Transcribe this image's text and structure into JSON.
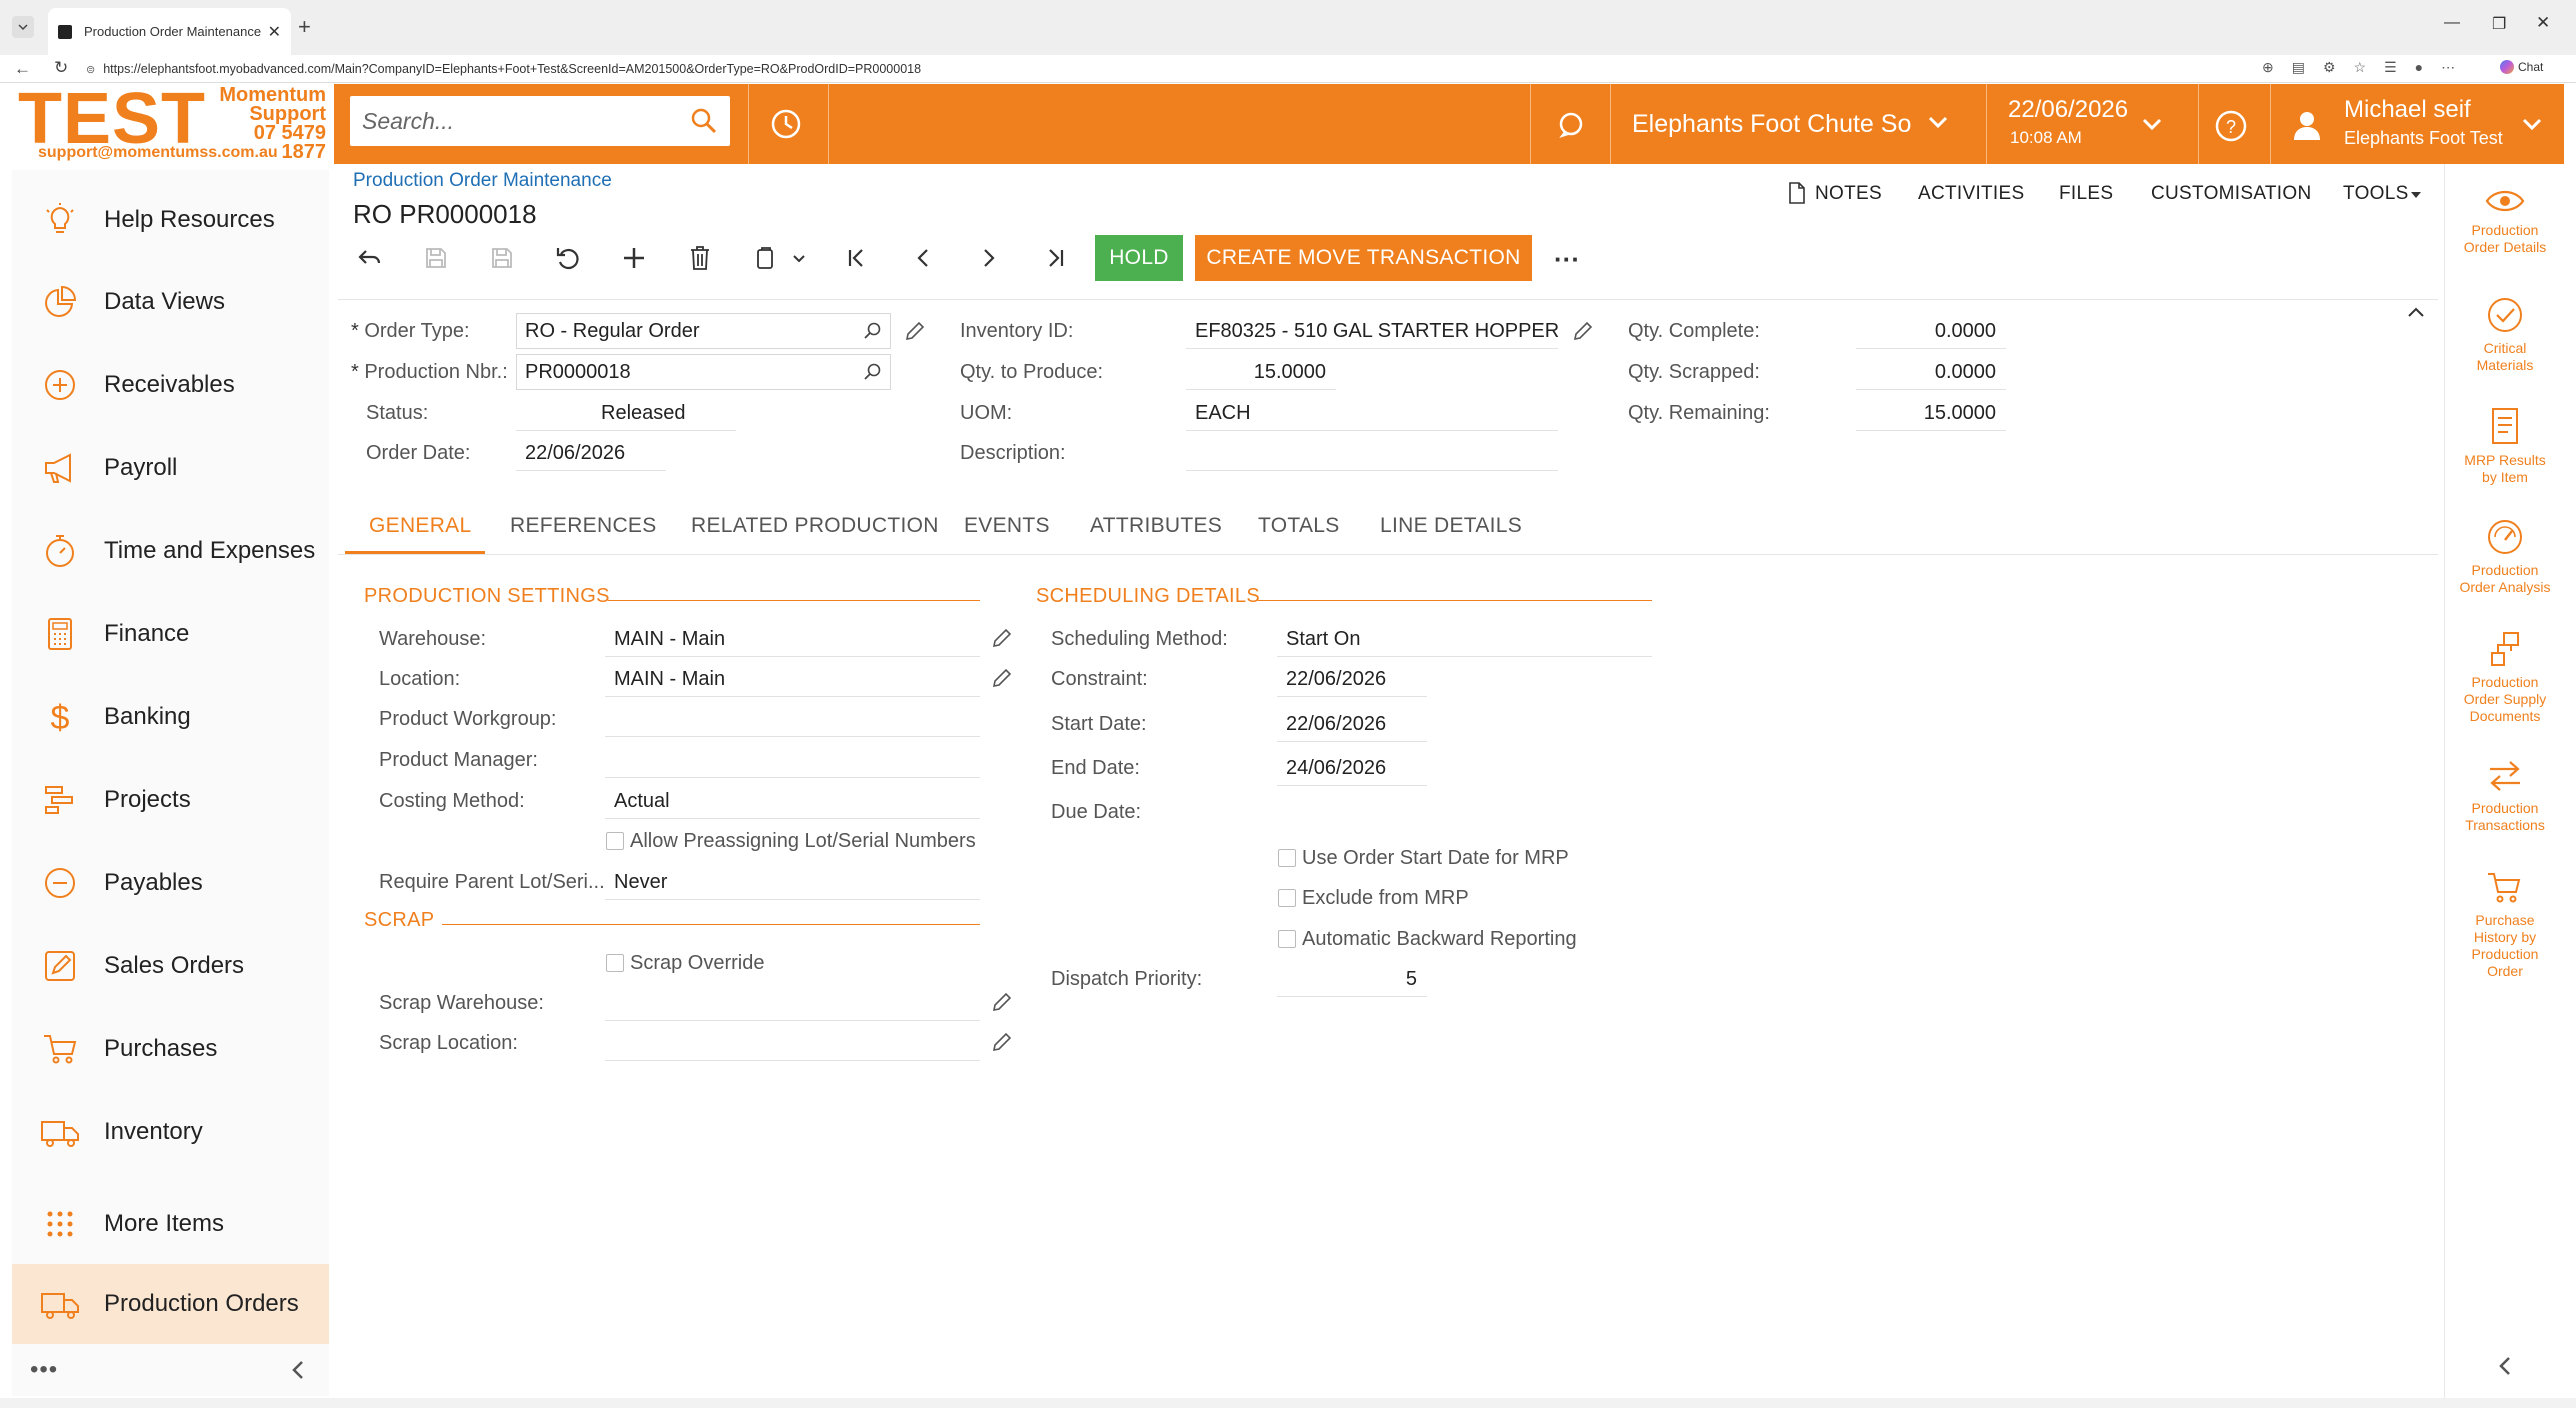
{
  "browser": {
    "tab_title": "Production Order Maintenance",
    "url": "https://elephantsfoot.myobadvanced.com/Main?CompanyID=Elephants+Foot+Test&ScreenId=AM201500&OrderType=RO&ProdOrdID=PR0000018",
    "chat_label": "Chat"
  },
  "logo": {
    "big": "TEST",
    "line1": "Momentum",
    "line2": "Support",
    "phone": "07 5479 1877",
    "email": "support@momentumss.com.au"
  },
  "header": {
    "search_placeholder": "Search...",
    "company": "Elephants Foot Chute Sol...",
    "date": "22/06/2026",
    "time": "10:08 AM",
    "user_name": "Michael seif",
    "user_company": "Elephants Foot Test"
  },
  "sidebar": {
    "items": [
      {
        "label": "Help Resources",
        "icon": "lightbulb-icon"
      },
      {
        "label": "Data Views",
        "icon": "pie-chart-icon"
      },
      {
        "label": "Receivables",
        "icon": "plus-circle-icon"
      },
      {
        "label": "Payroll",
        "icon": "megaphone-icon"
      },
      {
        "label": "Time and Expenses",
        "icon": "stopwatch-icon"
      },
      {
        "label": "Finance",
        "icon": "calculator-icon"
      },
      {
        "label": "Banking",
        "icon": "dollar-icon"
      },
      {
        "label": "Projects",
        "icon": "projects-icon"
      },
      {
        "label": "Payables",
        "icon": "minus-circle-icon"
      },
      {
        "label": "Sales Orders",
        "icon": "edit-icon"
      },
      {
        "label": "Purchases",
        "icon": "cart-icon"
      },
      {
        "label": "Inventory",
        "icon": "truck-icon"
      },
      {
        "label": "More Items",
        "icon": "grid-dots-icon"
      },
      {
        "label": "Production Orders",
        "icon": "truck-icon"
      }
    ]
  },
  "page": {
    "breadcrumb": "Production Order Maintenance",
    "title": "RO PR0000018"
  },
  "toolbar": {
    "hold_label": "HOLD",
    "create_move_label": "CREATE MOVE TRANSACTION",
    "more": "···",
    "notes": "NOTES",
    "activities": "ACTIVITIES",
    "files": "FILES",
    "customisation": "CUSTOMISATION",
    "tools": "TOOLS"
  },
  "summary": {
    "order_type_label": "Order Type:",
    "order_type": "RO - Regular Order",
    "production_nbr_label": "Production Nbr.:",
    "production_nbr": "PR0000018",
    "status_label": "Status:",
    "status": "Released",
    "order_date_label": "Order Date:",
    "order_date": "22/06/2026",
    "inventory_id_label": "Inventory ID:",
    "inventory_id": "EF80325 - 510 GAL STARTER HOPPER",
    "qty_to_produce_label": "Qty. to Produce:",
    "qty_to_produce": "15.0000",
    "uom_label": "UOM:",
    "uom": "EACH",
    "description_label": "Description:",
    "qty_complete_label": "Qty. Complete:",
    "qty_complete": "0.0000",
    "qty_scrapped_label": "Qty. Scrapped:",
    "qty_scrapped": "0.0000",
    "qty_remaining_label": "Qty. Remaining:",
    "qty_remaining": "15.0000"
  },
  "tabs": [
    "GENERAL",
    "REFERENCES",
    "RELATED PRODUCTION",
    "EVENTS",
    "ATTRIBUTES",
    "TOTALS",
    "LINE DETAILS"
  ],
  "production_settings": {
    "heading": "PRODUCTION SETTINGS",
    "warehouse_label": "Warehouse:",
    "warehouse": "MAIN - Main",
    "location_label": "Location:",
    "location": "MAIN - Main",
    "workgroup_label": "Product Workgroup:",
    "manager_label": "Product Manager:",
    "costing_label": "Costing Method:",
    "costing": "Actual",
    "preassign_label": "Allow Preassigning Lot/Serial Numbers",
    "parent_lot_label": "Require Parent Lot/Seri...",
    "parent_lot": "Never"
  },
  "scrap": {
    "heading": "SCRAP",
    "override_label": "Scrap Override",
    "warehouse_label": "Scrap Warehouse:",
    "location_label": "Scrap Location:"
  },
  "scheduling": {
    "heading": "SCHEDULING DETAILS",
    "method_label": "Scheduling Method:",
    "method": "Start On",
    "constraint_label": "Constraint:",
    "constraint": "22/06/2026",
    "start_label": "Start Date:",
    "start": "22/06/2026",
    "end_label": "End Date:",
    "end": "24/06/2026",
    "due_label": "Due Date:",
    "use_start_label": "Use Order Start Date for MRP",
    "exclude_label": "Exclude from MRP",
    "backward_label": "Automatic Backward Reporting",
    "dispatch_label": "Dispatch Priority:",
    "dispatch": "5"
  },
  "right_panel": [
    {
      "l1": "Production",
      "l2": "Order Details",
      "l3": "",
      "l4": ""
    },
    {
      "l1": "Critical",
      "l2": "Materials",
      "l3": "",
      "l4": ""
    },
    {
      "l1": "MRP Results",
      "l2": "by Item",
      "l3": "",
      "l4": ""
    },
    {
      "l1": "Production",
      "l2": "Order Analysis",
      "l3": "",
      "l4": ""
    },
    {
      "l1": "Production",
      "l2": "Order Supply",
      "l3": "Documents",
      "l4": ""
    },
    {
      "l1": "Production",
      "l2": "Transactions",
      "l3": "",
      "l4": ""
    },
    {
      "l1": "Purchase",
      "l2": "History by",
      "l3": "Production",
      "l4": "Order"
    }
  ],
  "colors": {
    "accent": "#f0801e",
    "hold_green": "#4caf50",
    "link_blue": "#1f6fb5"
  }
}
